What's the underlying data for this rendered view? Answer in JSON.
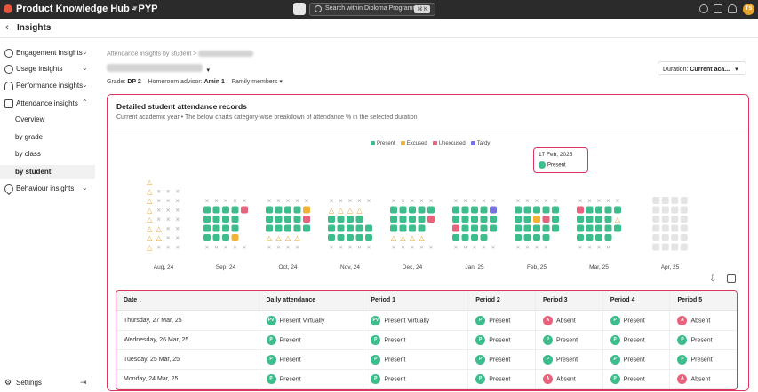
{
  "topbar": {
    "title": "Product Knowledge Hub - PYP",
    "search_placeholder": "Search within Diploma Programme...",
    "kbd": "⌘ K",
    "avatar": "TS"
  },
  "subbar": {
    "title": "Insights"
  },
  "sidebar": {
    "items": [
      {
        "label": "Engagement insights"
      },
      {
        "label": "Usage insights"
      },
      {
        "label": "Performance insights"
      },
      {
        "label": "Attendance insights"
      },
      {
        "label": "Overview"
      },
      {
        "label": "by grade"
      },
      {
        "label": "by class"
      },
      {
        "label": "by student"
      },
      {
        "label": "Behaviour insights"
      }
    ],
    "settings": "Settings"
  },
  "header": {
    "crumb": "Attendance insights by student",
    "grade_label": "Grade:",
    "grade": "DP 2",
    "advisor_label": "Homeroom advisor:",
    "advisor": "Amin 1",
    "family": "Family members",
    "duration_label": "Duration:",
    "duration": "Current aca..."
  },
  "card": {
    "title": "Detailed student attendance records",
    "subtitle": "Current academic year  •  The below charts category-wise breakdown of attendance % in the selected duration"
  },
  "legend": [
    {
      "label": "Present",
      "color": "#3dbd8c"
    },
    {
      "label": "Excused",
      "color": "#f2b233"
    },
    {
      "label": "Unexcused",
      "color": "#e8627c"
    },
    {
      "label": "Tardy",
      "color": "#7472e0"
    }
  ],
  "months": [
    "Aug, 24",
    "Sep, 24",
    "Oct, 24",
    "Nov, 24",
    "Dec, 24",
    "Jan, 25",
    "Feb, 25",
    "Mar, 25",
    "Apr, 25"
  ],
  "tooltip": {
    "date": "17 Feb, 2025",
    "status": "Present",
    "badge": "P"
  },
  "table": {
    "headers": [
      "Date",
      "Daily attendance",
      "Period 1",
      "Period 2",
      "Period 3",
      "Period 4",
      "Period 5"
    ],
    "rows": [
      {
        "date": "Thursday, 27 Mar, 25",
        "cells": [
          [
            "PV",
            "Present Virtually"
          ],
          [
            "PV",
            "Present Virtually"
          ],
          [
            "P",
            "Present"
          ],
          [
            "A",
            "Absent"
          ],
          [
            "P",
            "Present"
          ],
          [
            "A",
            "Absent"
          ]
        ]
      },
      {
        "date": "Wednesday, 26 Mar, 25",
        "cells": [
          [
            "P",
            "Present"
          ],
          [
            "P",
            "Present"
          ],
          [
            "P",
            "Present"
          ],
          [
            "P",
            "Present"
          ],
          [
            "P",
            "Present"
          ],
          [
            "P",
            "Present"
          ]
        ]
      },
      {
        "date": "Tuesday, 25 Mar, 25",
        "cells": [
          [
            "P",
            "Present"
          ],
          [
            "P",
            "Present"
          ],
          [
            "P",
            "Present"
          ],
          [
            "P",
            "Present"
          ],
          [
            "P",
            "Present"
          ],
          [
            "P",
            "Present"
          ]
        ]
      },
      {
        "date": "Monday, 24 Mar, 25",
        "cells": [
          [
            "P",
            "Present"
          ],
          [
            "P",
            "Present"
          ],
          [
            "P",
            "Present"
          ],
          [
            "A",
            "Absent"
          ],
          [
            "P",
            "Present"
          ],
          [
            "A",
            "Absent"
          ]
        ]
      }
    ]
  }
}
